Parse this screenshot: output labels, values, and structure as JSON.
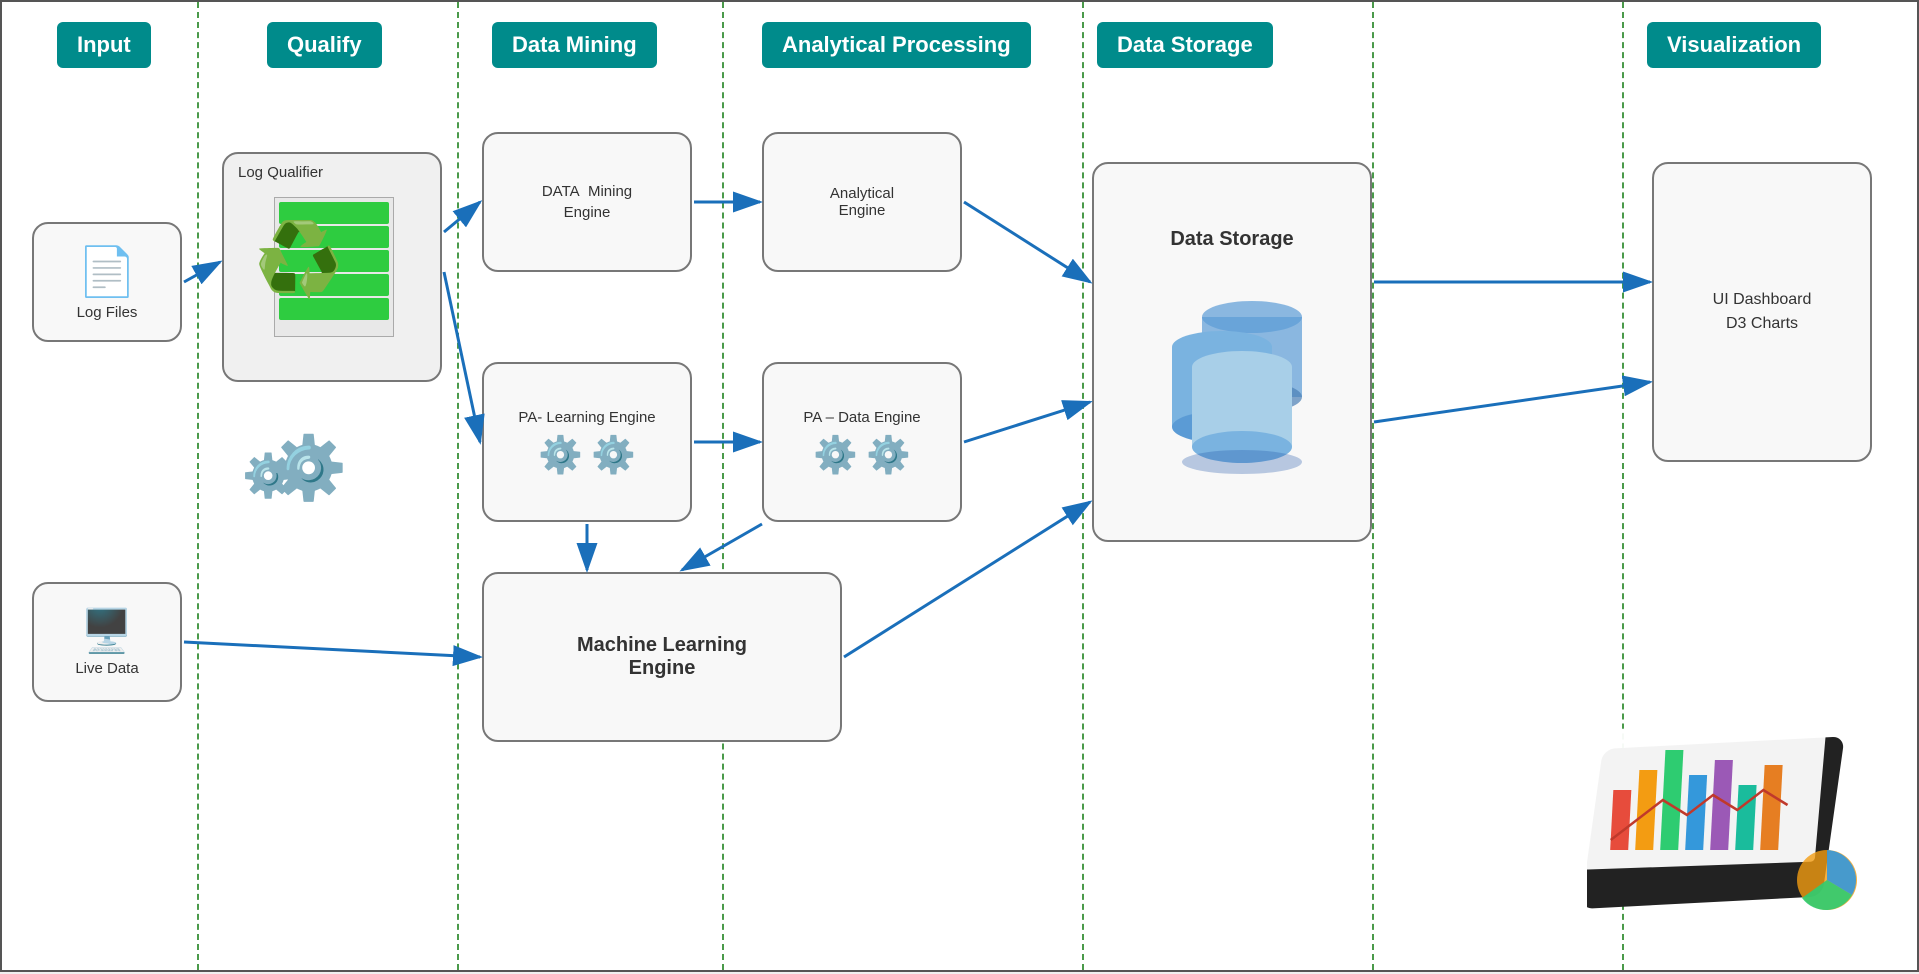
{
  "headers": {
    "input": "Input",
    "qualify": "Qualify",
    "dataMining": "Data Mining",
    "analyticalProcessing": "Analytical Processing",
    "dataStorage": "Data Storage",
    "visualization": "Visualization"
  },
  "components": {
    "logFiles": "Log Files",
    "liveData": "Live Data",
    "logQualifier": "Log Qualifier",
    "dataMiningEngine": "DATA  Mining\nEngine",
    "analyticalEngine": "Analytical\nEngine",
    "paLearningEngine": "PA- Learning Engine",
    "paDataEngine": "PA – Data Engine",
    "machineLearningEngine": "Machine Learning\nEngine",
    "dataStorage": "Data Storage",
    "uiDashboard": "UI Dashboard\nD3 Charts"
  }
}
